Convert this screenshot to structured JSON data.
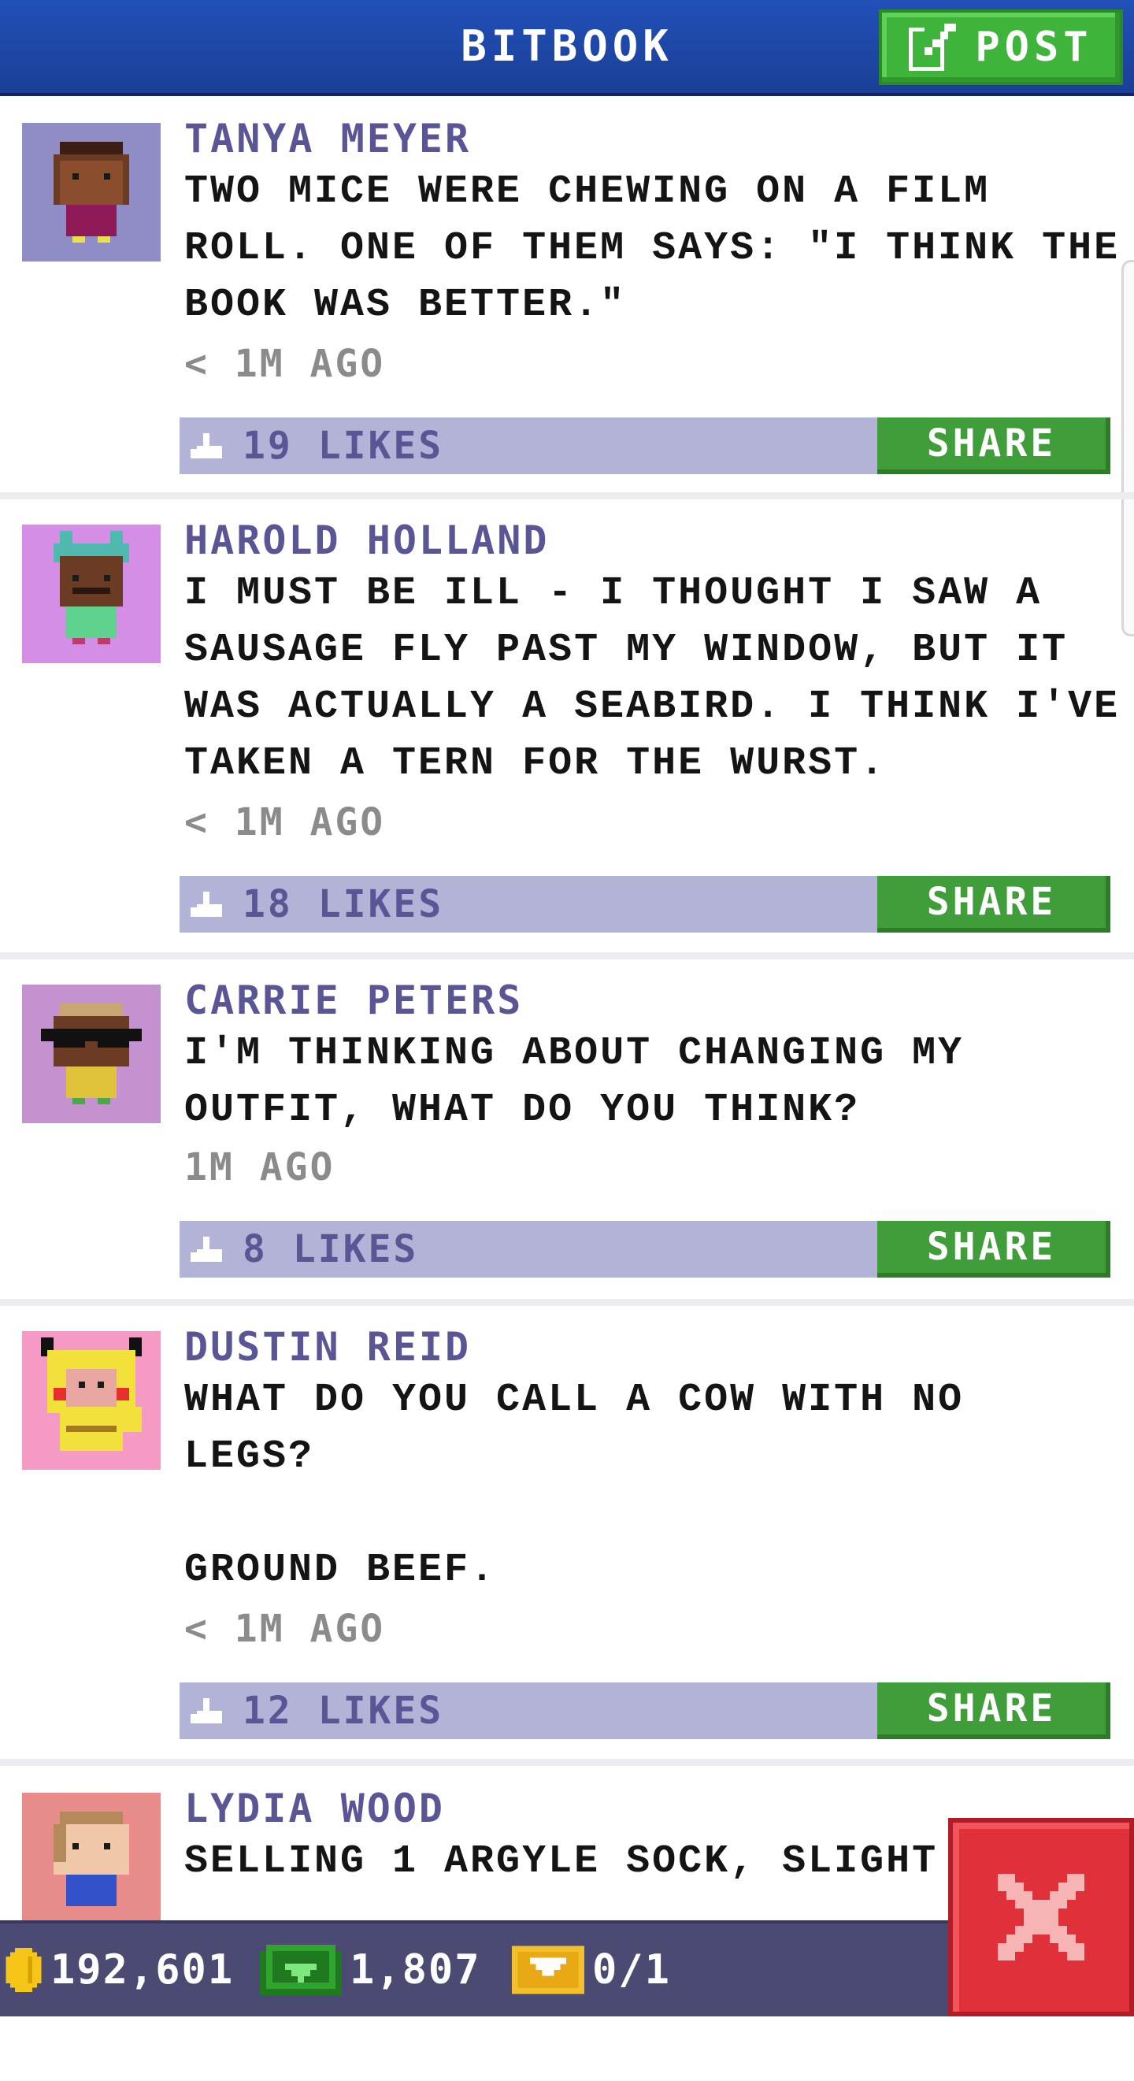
{
  "header": {
    "title": "BITBOOK",
    "post_label": "POST",
    "post_icon": "edit-icon",
    "colors": {
      "bar": "#1f4aa8",
      "post_button": "#3fb43a"
    }
  },
  "posts": [
    {
      "author": "TANYA MEYER",
      "text": "TWO MICE WERE CHEWING ON A FILM\nROLL. ONE OF THEM SAYS: \"I THINK THE\nBOOK WAS BETTER.\"",
      "time": "< 1M AGO",
      "likes": "19 LIKES",
      "share_label": "SHARE",
      "avatar_bg": "#8f8cc6"
    },
    {
      "author": "HAROLD HOLLAND",
      "text": "I MUST BE ILL - I THOUGHT I SAW A\nSAUSAGE FLY PAST MY WINDOW, BUT IT\nWAS ACTUALLY A SEABIRD. I THINK I'VE\nTAKEN A TERN FOR THE WURST.",
      "time": "< 1M AGO",
      "likes": "18 LIKES",
      "share_label": "SHARE",
      "avatar_bg": "#d48ee6"
    },
    {
      "author": "CARRIE PETERS",
      "text": "I'M THINKING ABOUT CHANGING MY\nOUTFIT, WHAT DO YOU THINK?",
      "time": "1M AGO",
      "likes": "8 LIKES",
      "share_label": "SHARE",
      "avatar_bg": "#c493cf"
    },
    {
      "author": "DUSTIN REID",
      "text": "WHAT DO YOU CALL A COW WITH NO\nLEGS?\n\nGROUND BEEF.",
      "time": "< 1M AGO",
      "likes": "12 LIKES",
      "share_label": "SHARE",
      "avatar_bg": "#f59ac4"
    },
    {
      "author": "LYDIA WOOD",
      "text": "SELLING 1 ARGYLE SOCK, SLIGHT",
      "avatar_bg": "#e88b8b"
    }
  ],
  "bottom_bar": {
    "coins": "192,601",
    "bux": "1,807",
    "tickets": "0/1",
    "icons": [
      "coin-icon",
      "bux-icon",
      "ticket-icon"
    ],
    "close_icon": "close-icon"
  }
}
